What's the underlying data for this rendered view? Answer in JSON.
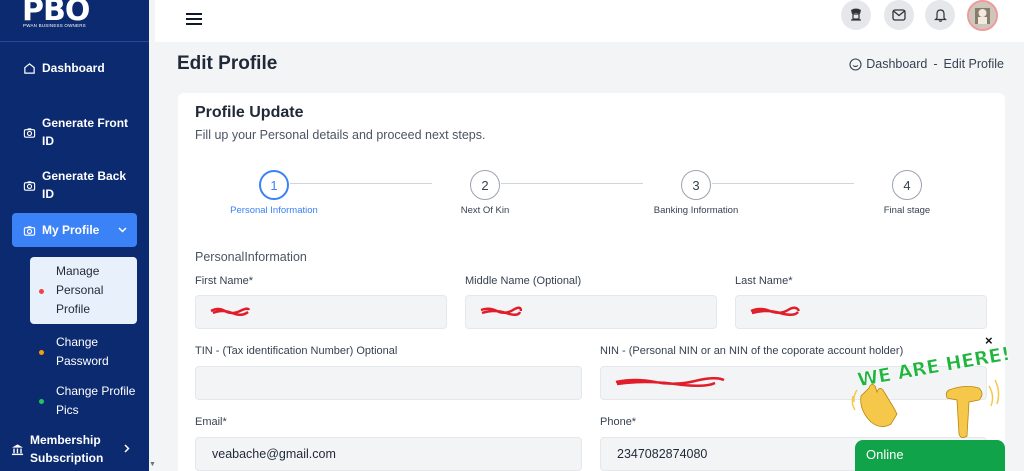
{
  "brand": {
    "logo": "PBO",
    "tagline": "PWAN BUSINESS OWNERS"
  },
  "sidebar": {
    "items": [
      {
        "label": "Dashboard"
      },
      {
        "label": "Generate Front ID"
      },
      {
        "label": "Generate Back ID"
      },
      {
        "label": "My Profile"
      },
      {
        "label": "Membership Subscription"
      }
    ],
    "submenu": [
      {
        "label": "Manage Personal Profile",
        "dot_color": "#ef4444"
      },
      {
        "label": "Change Password",
        "dot_color": "#f59e0b"
      },
      {
        "label": "Change Profile Pics",
        "dot_color": "#22c55e"
      }
    ]
  },
  "topbar": {
    "icons": [
      "emblem-icon",
      "mail-icon",
      "bell-icon"
    ]
  },
  "page": {
    "title": "Edit Profile",
    "breadcrumb": {
      "home": "Dashboard",
      "separator": "-",
      "current": "Edit Profile"
    }
  },
  "card": {
    "title": "Profile Update",
    "subtitle": "Fill up your Personal details and proceed next steps.",
    "steps": [
      {
        "num": "1",
        "label": "Personal Information"
      },
      {
        "num": "2",
        "label": "Next Of Kin"
      },
      {
        "num": "3",
        "label": "Banking Information"
      },
      {
        "num": "4",
        "label": "Final stage"
      }
    ],
    "section": "PersonalInformation",
    "fields": {
      "first_name": {
        "label": "First Name*"
      },
      "middle_name": {
        "label": "Middle Name (Optional)"
      },
      "last_name": {
        "label": "Last Name*"
      },
      "tin": {
        "label": "TIN - (Tax identification Number) Optional"
      },
      "nin": {
        "label": "NIN - (Personal NIN or an NIN of the coporate account holder)"
      },
      "email": {
        "label": "Email*",
        "value": "veabache@gmail.com"
      },
      "phone": {
        "label": "Phone*",
        "value": "2347082874080"
      }
    }
  },
  "widget": {
    "banner": "WE ARE HERE!",
    "status": "Online",
    "close": "×"
  },
  "colors": {
    "sidebar": "#0b2a6f",
    "accent": "#3b82f6",
    "online": "#10a34a",
    "redaction": "#e11d2a"
  }
}
